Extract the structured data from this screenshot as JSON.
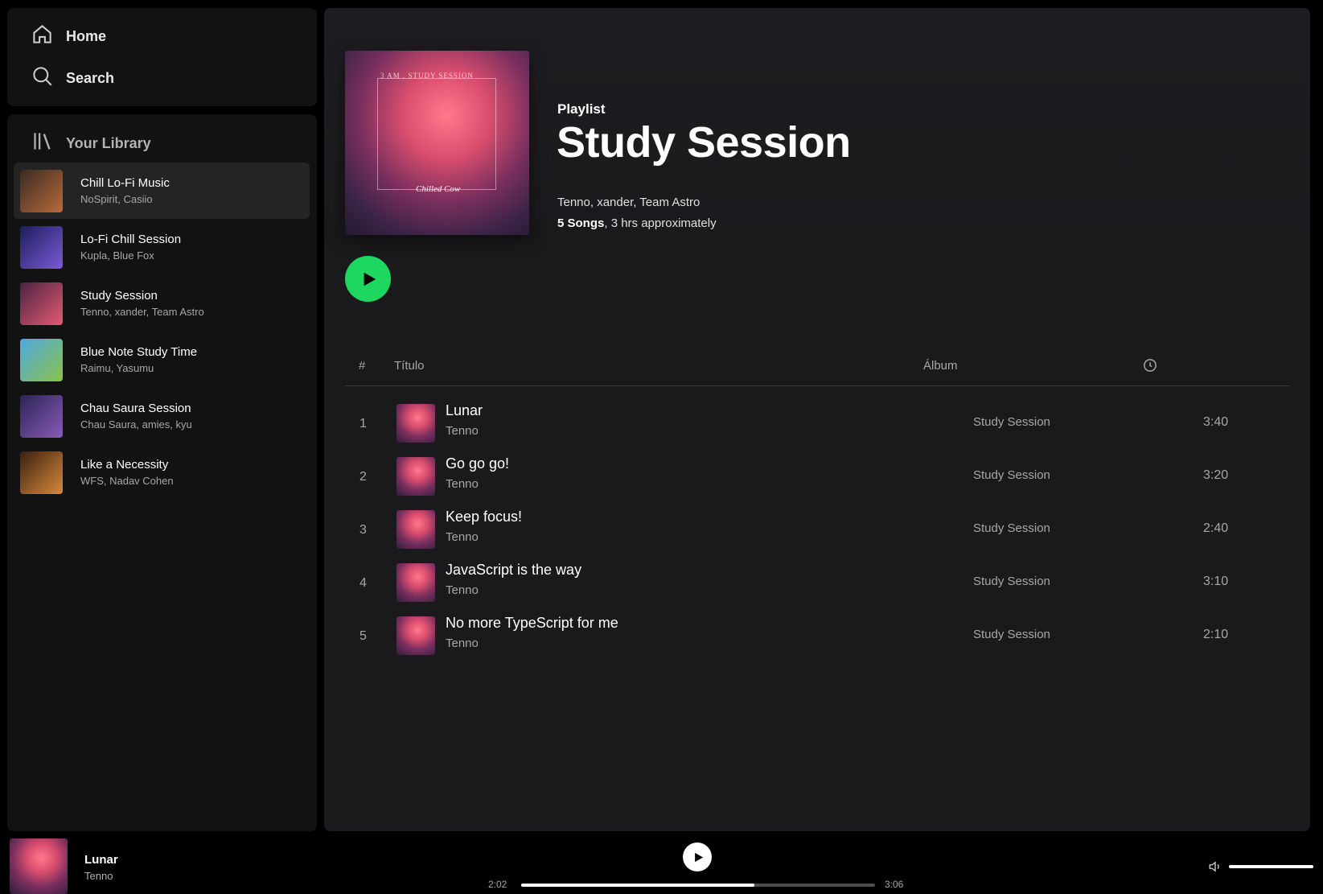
{
  "nav": {
    "home": "Home",
    "search": "Search"
  },
  "library": {
    "label": "Your Library",
    "items": [
      {
        "title": "Chill Lo-Fi Music",
        "subtitle": "NoSpirit, Casiio",
        "colors": [
          "#3a2a22",
          "#b86a3a"
        ]
      },
      {
        "title": "Lo-Fi Chill Session",
        "subtitle": "Kupla, Blue Fox",
        "colors": [
          "#1d1d5c",
          "#7a5bd6"
        ]
      },
      {
        "title": "Study Session",
        "subtitle": "Tenno, xander, Team Astro",
        "colors": [
          "#4a2342",
          "#e45a72"
        ]
      },
      {
        "title": "Blue Note Study Time",
        "subtitle": "Raimu, Yasumu",
        "colors": [
          "#4fa8e0",
          "#8bc24a"
        ]
      },
      {
        "title": "Chau Saura Session",
        "subtitle": "Chau Saura, amies, kyu",
        "colors": [
          "#2b2456",
          "#8a5ab8"
        ]
      },
      {
        "title": "Like a Necessity",
        "subtitle": "WFS, Nadav Cohen",
        "colors": [
          "#3a1f12",
          "#d98a3a"
        ]
      }
    ]
  },
  "playlist": {
    "type": "Playlist",
    "title": "Study Session",
    "artists": "Tenno, xander, Team Astro",
    "songs_count": "5 Songs",
    "duration": ", 3 hrs approximately",
    "cover_text": "3 AM . STUDY SESSION",
    "cover_logo": "Chilled Cow"
  },
  "table": {
    "headers": {
      "num": "#",
      "title": "Título",
      "album": "Álbum"
    },
    "rows": [
      {
        "num": "1",
        "title": "Lunar",
        "artist": "Tenno",
        "album": "Study Session",
        "duration": "3:40"
      },
      {
        "num": "2",
        "title": "Go go go!",
        "artist": "Tenno",
        "album": "Study Session",
        "duration": "3:20"
      },
      {
        "num": "3",
        "title": "Keep focus!",
        "artist": "Tenno",
        "album": "Study Session",
        "duration": "2:40"
      },
      {
        "num": "4",
        "title": "JavaScript is the way",
        "artist": "Tenno",
        "album": "Study Session",
        "duration": "3:10"
      },
      {
        "num": "5",
        "title": "No more TypeScript for me",
        "artist": "Tenno",
        "album": "Study Session",
        "duration": "2:10"
      }
    ]
  },
  "player": {
    "title": "Lunar",
    "artist": "Tenno",
    "current": "2:02",
    "total": "3:06",
    "progress": 0.66,
    "volume": 1.0
  },
  "colors": {
    "accent": "#1ed760",
    "background": "#1a1a1d",
    "sidebar": "#121212"
  }
}
